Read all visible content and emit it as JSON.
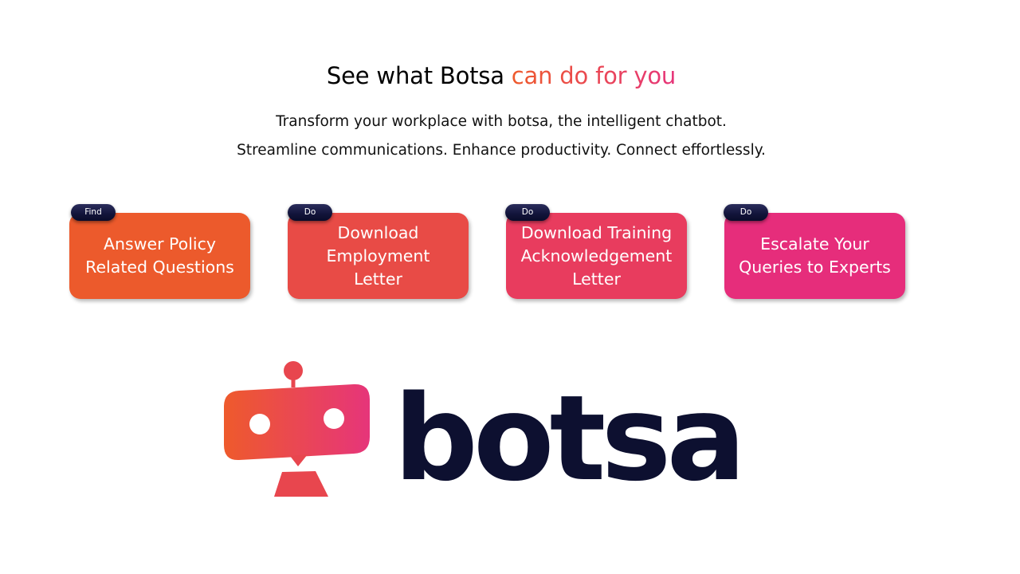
{
  "heading": {
    "prefix": "See what Botsa ",
    "accent": "can do for you",
    "accent_gradient": [
      "#ee5a2c",
      "#e6357a"
    ]
  },
  "subheading": {
    "line1": "Transform your workplace with botsa, the intelligent chatbot.",
    "line2": "Streamline communications. Enhance productivity.  Connect effortlessly."
  },
  "cards": [
    {
      "tag": "Find",
      "label": "Answer Policy\nRelated Questions",
      "color": "#ec5a2c"
    },
    {
      "tag": "Do",
      "label": "Download\nEmployment\nLetter",
      "color": "#e84b46"
    },
    {
      "tag": "Do",
      "label": "Download Training\nAcknowledgement\nLetter",
      "color": "#e83c5e"
    },
    {
      "tag": "Do",
      "label": "Escalate Your\nQueries to Experts",
      "color": "#e62d7b"
    }
  ],
  "brand": {
    "wordmark": "botsa",
    "wordmark_color": "#0d1030",
    "logo_icon": "robot-head-icon",
    "logo_gradient": [
      "#ee5a2c",
      "#e6357a"
    ]
  }
}
